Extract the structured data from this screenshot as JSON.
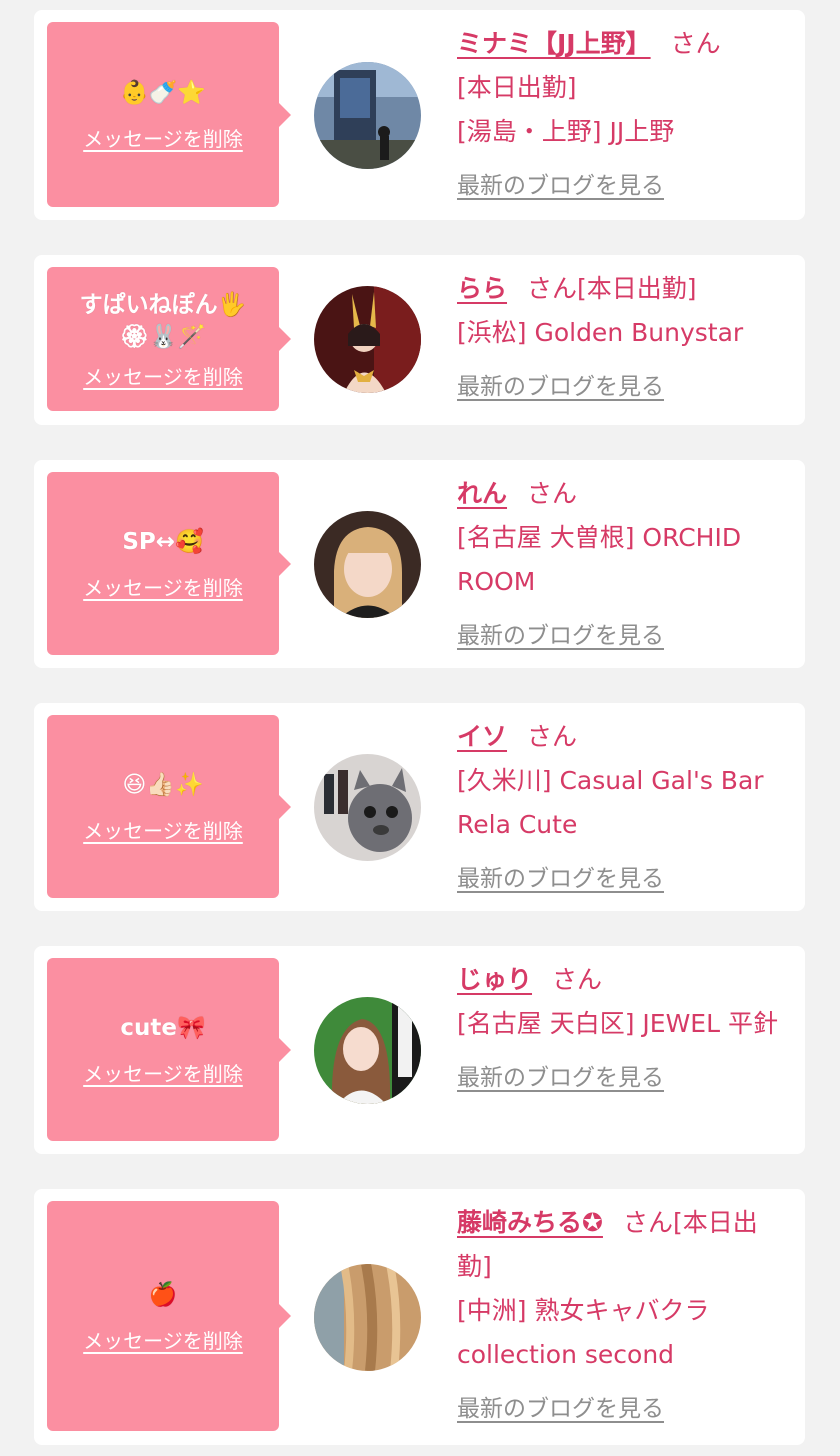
{
  "delete_label": "メッセージを削除",
  "blog_label": "最新のブログを見る",
  "honorific": "さん",
  "colors": {
    "bubble": "#fb8fa1",
    "accent": "#d63a66",
    "link_gray": "#8e8e8e",
    "page_bg": "#f2f2f2"
  },
  "items": [
    {
      "message": "👶🍼⭐",
      "name": "ミナミ【JJ上野】",
      "after_name": "",
      "lines": [
        "[本日出勤]",
        "[湯島・上野] JJ上野"
      ],
      "avatar_icon": "photo-street-avatar-icon"
    },
    {
      "message": "すぱいねぽん🖐 🏵🐰🪄",
      "name": "らら",
      "after_name": "[本日出勤]",
      "lines": [
        "[浜松] Golden Bunystar"
      ],
      "avatar_icon": "photo-bunny-avatar-icon"
    },
    {
      "message": "SP↔🥰",
      "name": "れん",
      "after_name": "",
      "lines": [
        "[名古屋 大曽根] ORCHID ROOM"
      ],
      "avatar_icon": "photo-portrait-avatar-icon"
    },
    {
      "message": "😆👍🏻✨",
      "name": "イソ",
      "after_name": "",
      "lines": [
        "[久米川] Casual Gal's Bar Rela Cute"
      ],
      "avatar_icon": "photo-cat-avatar-icon"
    },
    {
      "message": "cute🎀",
      "name": "じゅり",
      "after_name": "",
      "lines": [
        "[名古屋 天白区] JEWEL 平針"
      ],
      "avatar_icon": "photo-portrait-sign-avatar-icon"
    },
    {
      "message": "🍎",
      "name": "藤崎みちる✪",
      "after_name": "[本日出勤]",
      "lines": [
        "[中洲] 熟女キャバクラ collection second"
      ],
      "avatar_icon": "photo-hair-avatar-icon"
    }
  ]
}
